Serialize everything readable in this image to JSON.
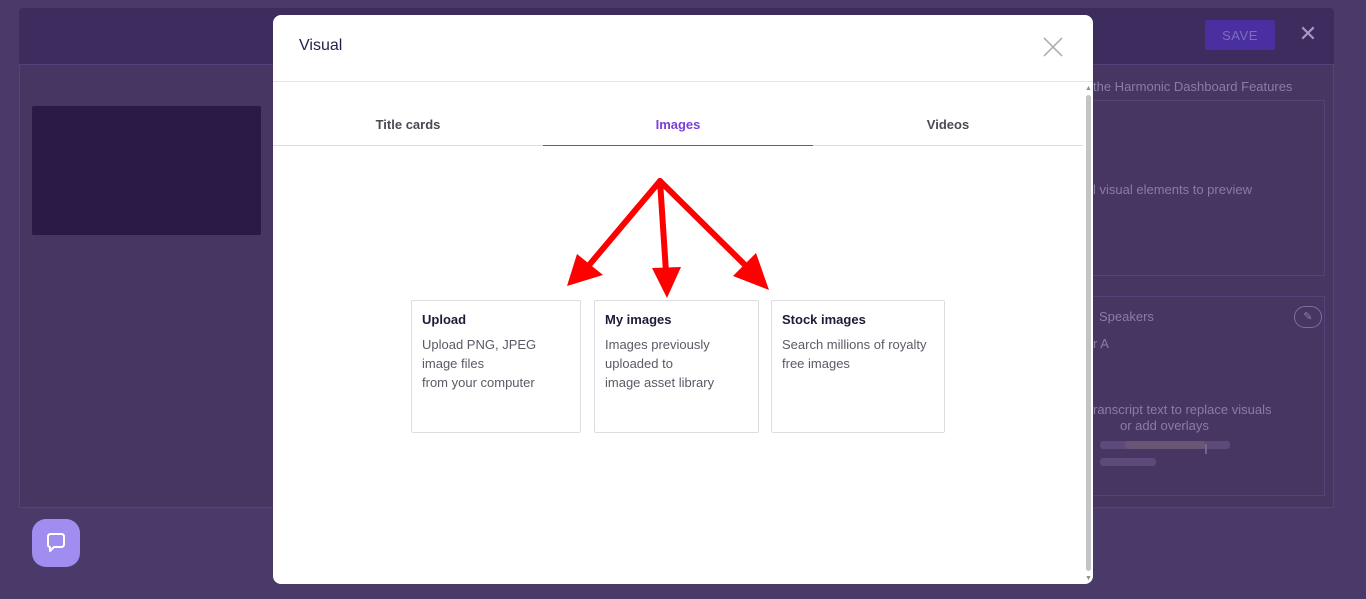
{
  "background": {
    "save_label": "SAVE",
    "close_glyph": "✕",
    "texts": {
      "title_fragment": "the Harmonic Dashboard Features",
      "preview_fragment": "l visual elements to preview",
      "speakers_fragment": "Speakers",
      "speaker_a_fragment": "r A",
      "transcript_line1": "ranscript text to replace visuals",
      "transcript_line2": "or add overlays"
    },
    "edit_glyph": "✎",
    "cursor_glyph": "I"
  },
  "modal": {
    "title": "Visual",
    "tabs": [
      {
        "label": "Title cards",
        "active": false
      },
      {
        "label": "Images",
        "active": true
      },
      {
        "label": "Videos",
        "active": false
      }
    ],
    "cards": [
      {
        "title": "Upload",
        "description": "Upload PNG, JPEG\nimage files\nfrom your computer"
      },
      {
        "title": "My images",
        "description": "Images previously\nuploaded to\nimage asset library"
      },
      {
        "title": "Stock images",
        "description": "Search millions of royalty\nfree images"
      }
    ],
    "scroll_up_glyph": "▲",
    "scroll_down_glyph": "▼"
  },
  "colors": {
    "accent": "#7c3fd8",
    "annotation_arrow": "#ff0000",
    "backdrop": "#4a3a6a"
  },
  "icons": [
    "close-icon",
    "chat-icon",
    "edit-icon"
  ]
}
